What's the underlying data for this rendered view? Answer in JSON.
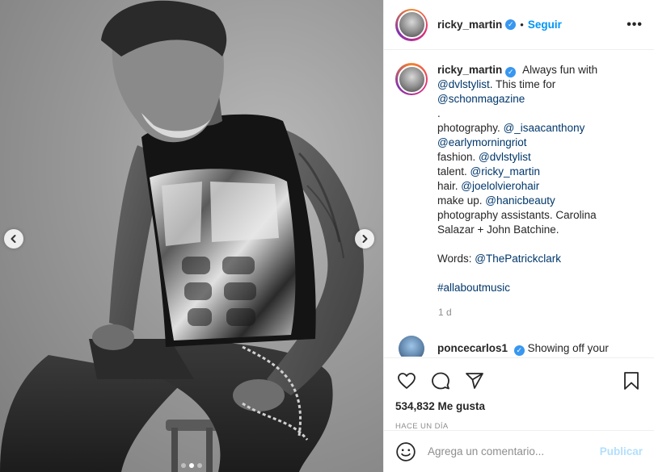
{
  "post": {
    "username": "ricky_martin",
    "follow_label": "Seguir",
    "separator": "•",
    "more_label": "•••"
  },
  "caption": {
    "username": "ricky_martin",
    "lines": [
      {
        "pre": "Always fun with",
        "mention": ""
      },
      {
        "pre": "",
        "mention": "@dvlstylist",
        "post": ". This time for"
      },
      {
        "pre": "",
        "mention": "@schonmagazine"
      },
      {
        "pre": ".",
        "mention": ""
      },
      {
        "pre": "photography. ",
        "mention": "@_isaacanthony"
      },
      {
        "pre": "",
        "mention": "@earlymorningriot"
      },
      {
        "pre": "fashion. ",
        "mention": "@dvlstylist"
      },
      {
        "pre": "talent. ",
        "mention": "@ricky_martin"
      },
      {
        "pre": "hair. ",
        "mention": "@joelolvierohair"
      },
      {
        "pre": "make up. ",
        "mention": "@hanicbeauty"
      },
      {
        "pre": "photography assistants. Carolina",
        "mention": ""
      },
      {
        "pre": "Salazar + John Batchine.",
        "mention": ""
      },
      {
        "pre": " ",
        "mention": ""
      },
      {
        "pre": "Words: ",
        "mention": "@ThePatrickclark"
      },
      {
        "pre": " ",
        "mention": ""
      },
      {
        "pre": "",
        "mention": "#allaboutmusic"
      }
    ],
    "time": "1 d"
  },
  "next_comment": {
    "username": "poncecarlos1",
    "text": "Showing off your"
  },
  "actions": {
    "likes": "534,832 Me gusta",
    "time_ago": "HACE UN DÍA"
  },
  "add_comment": {
    "placeholder": "Agrega un comentario...",
    "publish_label": "Publicar"
  },
  "carousel": {
    "slide_count": 3,
    "active_slide": 1
  },
  "colors": {
    "accent": "#0095f6",
    "verified": "#3897f0",
    "mention": "#00376b",
    "muted": "#8e8e8e",
    "publish_disabled": "#b2dffc"
  }
}
